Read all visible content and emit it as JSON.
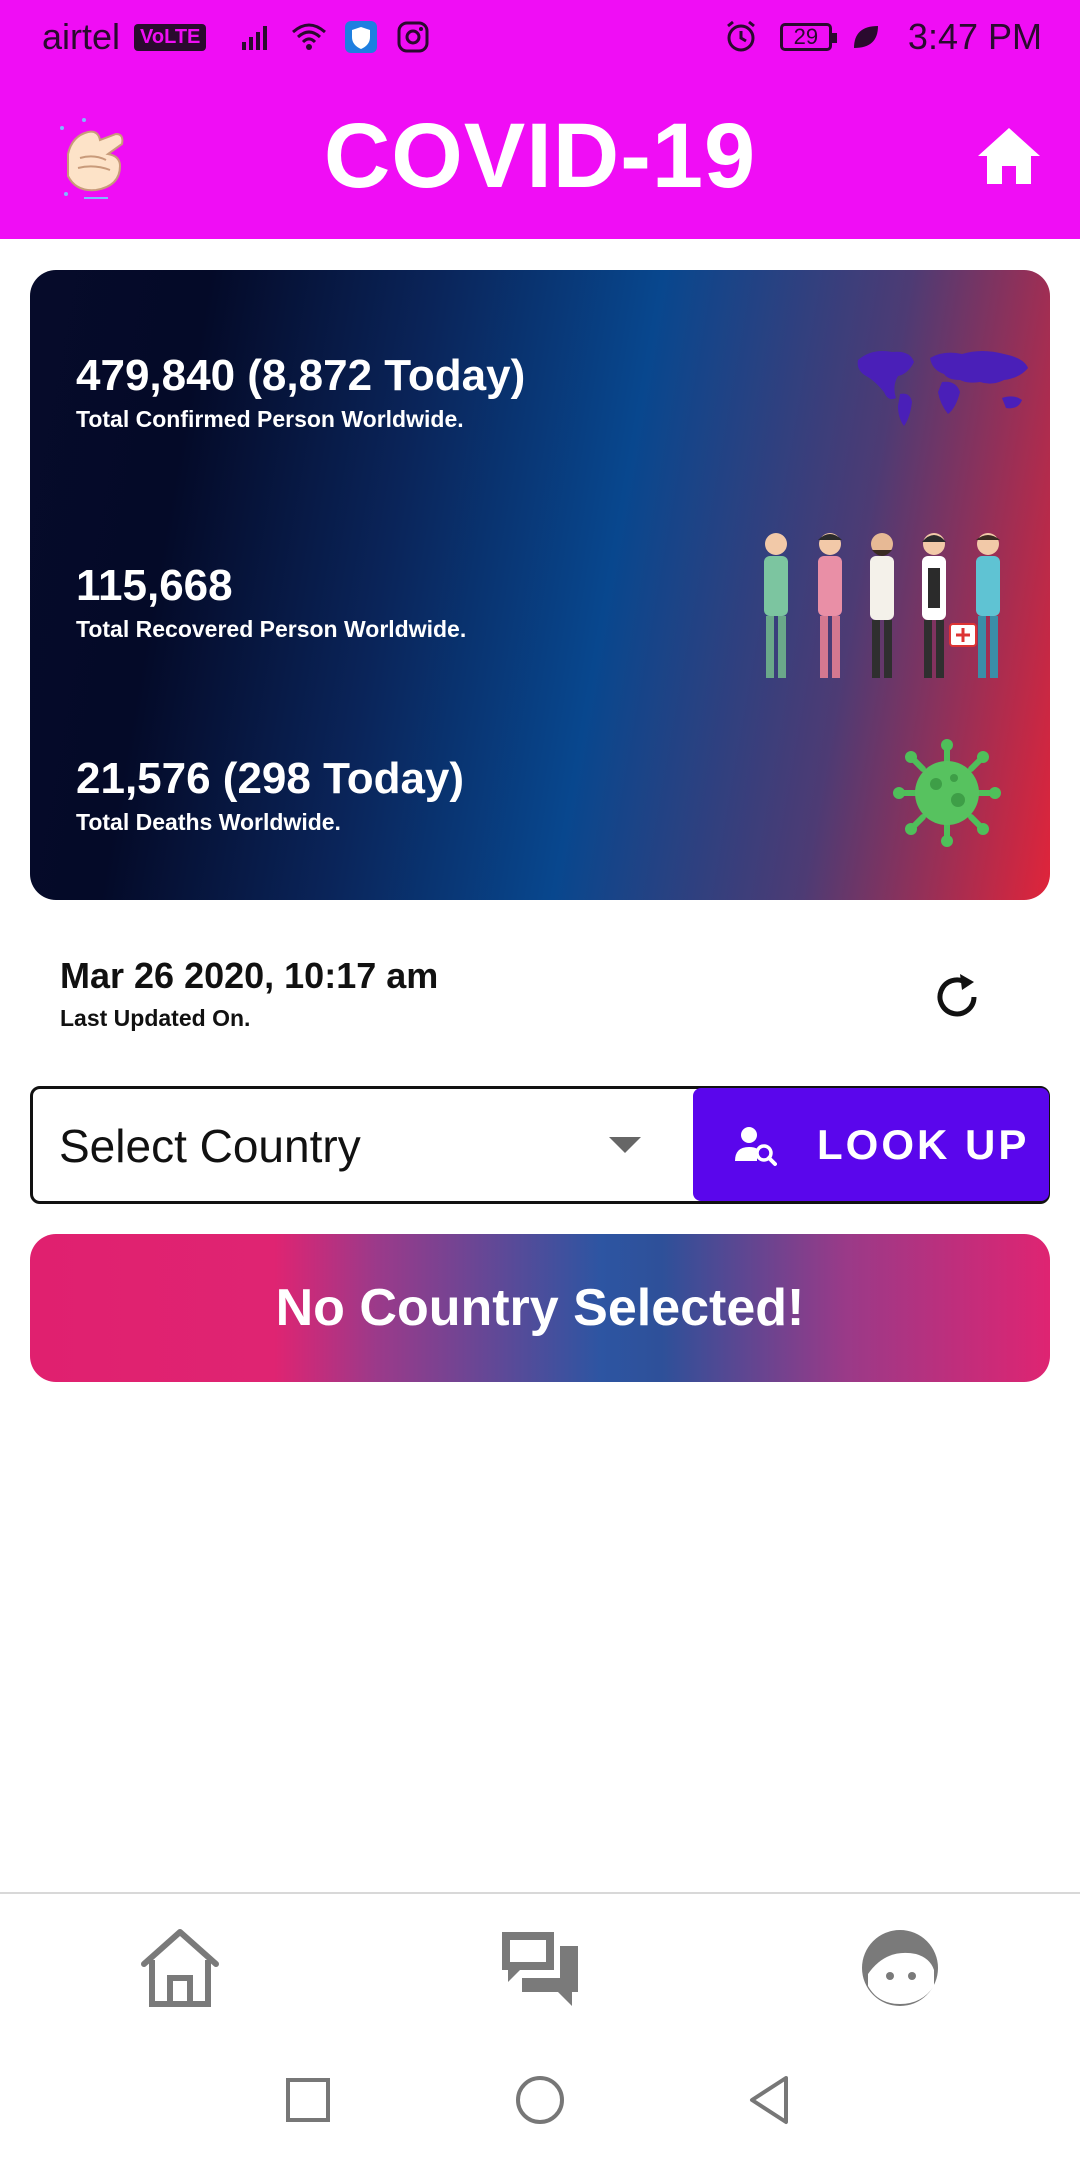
{
  "status_bar": {
    "carrier": "airtel",
    "network_badge": "VoLTE",
    "battery": "29",
    "time": "3:47 PM",
    "icons": [
      "signal-icon",
      "wifi-icon",
      "shield-app-icon",
      "instagram-icon",
      "alarm-icon",
      "leaf-icon"
    ]
  },
  "app_bar": {
    "title": "COVID-19",
    "left_icon": "hand-wash-icon",
    "right_icon": "home-icon"
  },
  "stats": [
    {
      "value": "479,840 (8,872 Today)",
      "label": "Total Confirmed Person Worldwide.",
      "icon": "world-map-icon"
    },
    {
      "value": "115,668",
      "label": "Total Recovered Person Worldwide.",
      "icon": "doctors-illustration"
    },
    {
      "value": "21,576 (298 Today)",
      "label": "Total Deaths Worldwide.",
      "icon": "virus-icon"
    }
  ],
  "updated": {
    "date": "Mar 26 2020, 10:17 am",
    "label": "Last Updated On.",
    "icon": "refresh-icon"
  },
  "selector": {
    "value": "Select Country",
    "button_label": "LOOK UP",
    "button_icon": "user-search-icon"
  },
  "banner": {
    "text": "No Country Selected!"
  },
  "bottom_nav": {
    "items": [
      "home-icon",
      "chat-icon",
      "profile-icon"
    ]
  },
  "colors": {
    "primary": "#f00df5",
    "lookup": "#5a06ec",
    "banner_pink": "#e0206f"
  }
}
